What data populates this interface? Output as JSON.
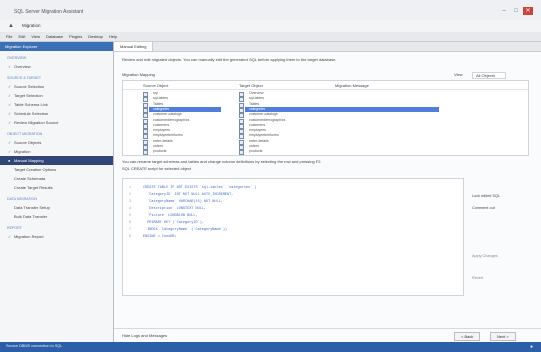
{
  "window": {
    "title": "SQL Server Migration Assistant",
    "controls": [
      "–",
      "□",
      "✕"
    ]
  },
  "nav": {
    "back_icon": "back-icon",
    "account": "Migration"
  },
  "menubar": [
    "File",
    "Edit",
    "View",
    "Database",
    "Plugins",
    "Desktop",
    "Help"
  ],
  "sidebar": {
    "header": "Migration Explorer",
    "sections": [
      {
        "title": "OVERVIEW",
        "items": [
          {
            "label": "Overview",
            "icon": "check-icon"
          }
        ]
      },
      {
        "title": "SOURCE & TARGET",
        "items": [
          {
            "label": "Source Selection",
            "icon": "check-icon"
          },
          {
            "label": "Target Selection",
            "icon": "check-icon"
          },
          {
            "label": "Table Schema Link",
            "icon": "check-icon"
          },
          {
            "label": "Schedule Selection",
            "icon": "check-icon"
          },
          {
            "label": "Review Migration Source",
            "icon": "check-icon"
          }
        ]
      },
      {
        "title": "OBJECT MIGRATION",
        "items": [
          {
            "label": "Source Objects",
            "icon": "check-icon"
          },
          {
            "label": "Migration",
            "icon": "check-icon"
          },
          {
            "label": "Manual Mapping",
            "icon": "dot-icon",
            "active": true
          },
          {
            "label": "Target Creation Options",
            "icon": "none"
          },
          {
            "label": "Create Schemata",
            "icon": "none"
          },
          {
            "label": "Create Target Results",
            "icon": "none"
          }
        ]
      },
      {
        "title": "DATA MIGRATION",
        "items": [
          {
            "label": "Data Transfer Setup",
            "icon": "none"
          },
          {
            "label": "Bulk Data Transfer",
            "icon": "none"
          }
        ]
      },
      {
        "title": "REPORT",
        "items": [
          {
            "label": "Migration Report",
            "icon": "check-icon"
          }
        ]
      }
    ]
  },
  "main": {
    "tab": "Manual Editing",
    "description": "Review and edit migrated objects. You can manually edit the generated SQL before applying them to the target database.",
    "grid_label": "Migration Mapping",
    "view_label": "View",
    "view_value": "All Objects",
    "columns": {
      "source": "Source Object",
      "target": "Target Object",
      "message": "Migration Message"
    },
    "rows": [
      {
        "source": "sql",
        "target": "Overview"
      },
      {
        "source": "sql-tables",
        "target": "sql-tables"
      },
      {
        "source": "Tables",
        "target": "Tables"
      },
      {
        "source": "categories",
        "target": "categories",
        "selected": true
      },
      {
        "source": "customer-catalogs",
        "target": "customer-catalogs"
      },
      {
        "source": "customerdemographics",
        "target": "customerdemographics"
      },
      {
        "source": "customers",
        "target": "customers"
      },
      {
        "source": "employees",
        "target": "employees"
      },
      {
        "source": "employeeterritories",
        "target": "employeeterritories"
      },
      {
        "source": "order-details",
        "target": "order-details"
      },
      {
        "source": "orders",
        "target": "orders"
      },
      {
        "source": "products",
        "target": "products"
      }
    ],
    "sql_caption": "You can rename target schemas and tables and change column definitions by selecting the row and pressing F2.",
    "sql_label": "SQL CREATE script for selected object",
    "code_lines": [
      "CREATE TABLE IF NOT EXISTS `sql-tables`.`categories` (",
      "  `CategoryID` INT NOT NULL AUTO_INCREMENT,",
      "  `CategoryName` VARCHAR(15) NOT NULL,",
      "  `Description` LONGTEXT NULL,",
      "  `Picture` LONGBLOB NULL,",
      "  PRIMARY KEY (`CategoryID`),",
      "  INDEX `CategoryName` (`CategoryName`))",
      "ENGINE = InnoDB;"
    ],
    "side_buttons": [
      "Lock edited SQL",
      "Comment out",
      "Apply Changes",
      "Revert"
    ],
    "footer": {
      "left": "Hide Logs and Messages",
      "back": "< Back",
      "next": "Next >"
    }
  },
  "status": {
    "text": "Source DBMS connection to SQL",
    "icon": "notification-icon"
  }
}
